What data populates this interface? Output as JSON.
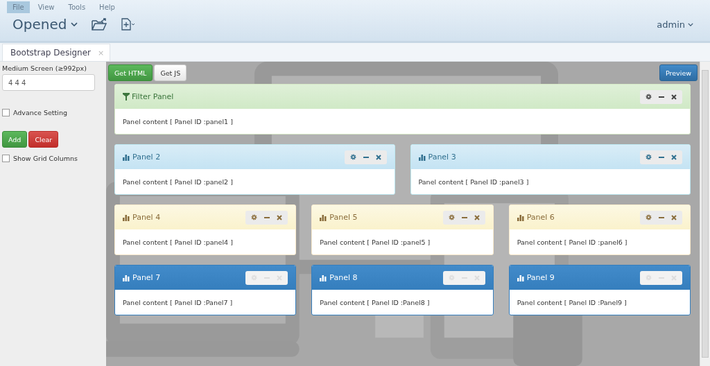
{
  "menu": [
    {
      "label": "File",
      "selected": true
    },
    {
      "label": "View",
      "selected": false
    },
    {
      "label": "Tools",
      "selected": false
    },
    {
      "label": "Help",
      "selected": false
    }
  ],
  "toolbar": {
    "title": "Opened",
    "user": "admin"
  },
  "tabs": [
    {
      "label": "Bootstrap Designer",
      "close": "×",
      "selected": true
    }
  ],
  "sidebar": {
    "screen_label": "Medium Screen (≥992px)",
    "layout_value": "4 4 4",
    "advance_setting": {
      "label": "Advance Setting",
      "checked": false
    },
    "add": "Add",
    "clear": "Clear",
    "show_grid": {
      "label": "Show Grid Columns",
      "checked": false
    }
  },
  "actions": {
    "get_html": "Get HTML",
    "get_js": "Get JS",
    "preview": "Preview"
  },
  "rows": [
    [
      {
        "kind": "success",
        "title": "Filter Panel",
        "content": "Panel content [ Panel ID :panel1 ]"
      }
    ],
    [
      {
        "kind": "info",
        "title": "Panel 2",
        "content": "Panel content [ Panel ID :panel2 ]"
      },
      {
        "kind": "info",
        "title": "Panel 3",
        "content": "Panel content [ Panel ID :panel3 ]"
      }
    ],
    [
      {
        "kind": "warning",
        "title": "Panel 4",
        "content": "Panel content [ Panel ID :panel4 ]"
      },
      {
        "kind": "warning",
        "title": "Panel 5",
        "content": "Panel content [ Panel ID :panel5 ]"
      },
      {
        "kind": "warning",
        "title": "Panel 6",
        "content": "Panel content [ Panel ID :panel6 ]"
      }
    ],
    [
      {
        "kind": "primary",
        "title": "Panel 7",
        "content": "Panel content [ Panel ID :Panel7 ]"
      },
      {
        "kind": "primary",
        "title": "Panel 8",
        "content": "Panel content [ Panel ID :Panel8 ]"
      },
      {
        "kind": "primary",
        "title": "Panel 9",
        "content": "Panel content [ Panel ID :Panel9 ]"
      }
    ]
  ]
}
